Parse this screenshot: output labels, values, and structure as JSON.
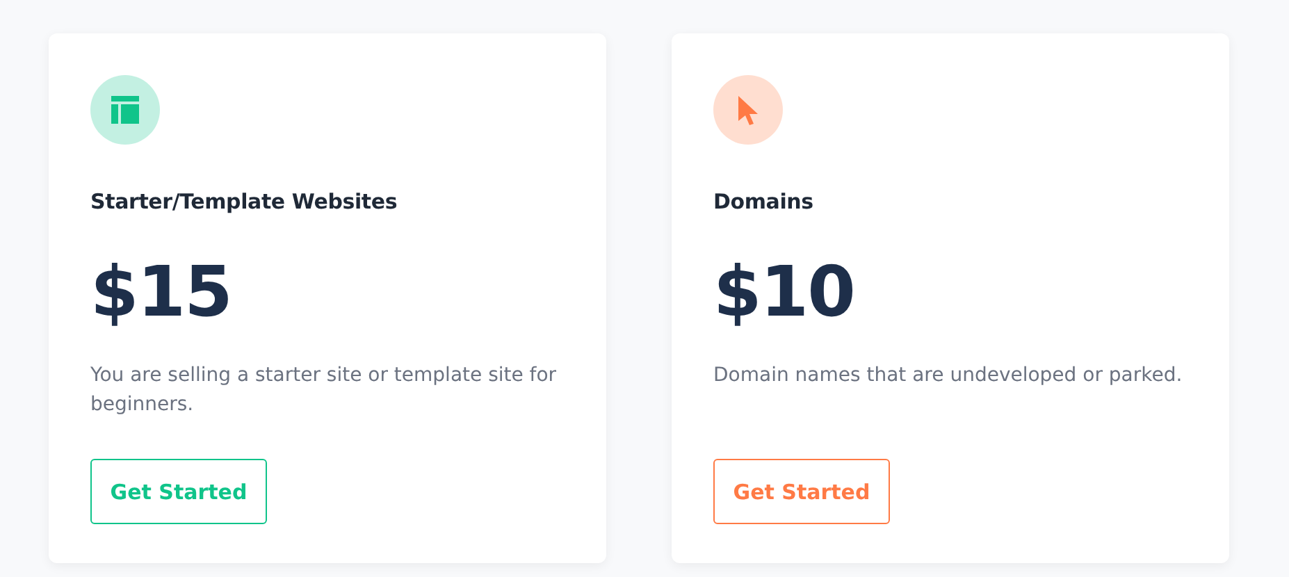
{
  "plans": [
    {
      "kind": "layout",
      "color": "#10c48a",
      "title": "Starter/Template Websites",
      "price": "$15",
      "description": "You are selling a starter site or template site for beginners.",
      "button": "Get Started"
    },
    {
      "kind": "cursor",
      "color": "#ff7a45",
      "title": "Domains",
      "price": "$10",
      "description": "Domain names that are undeveloped or parked.",
      "button": "Get Started"
    }
  ]
}
